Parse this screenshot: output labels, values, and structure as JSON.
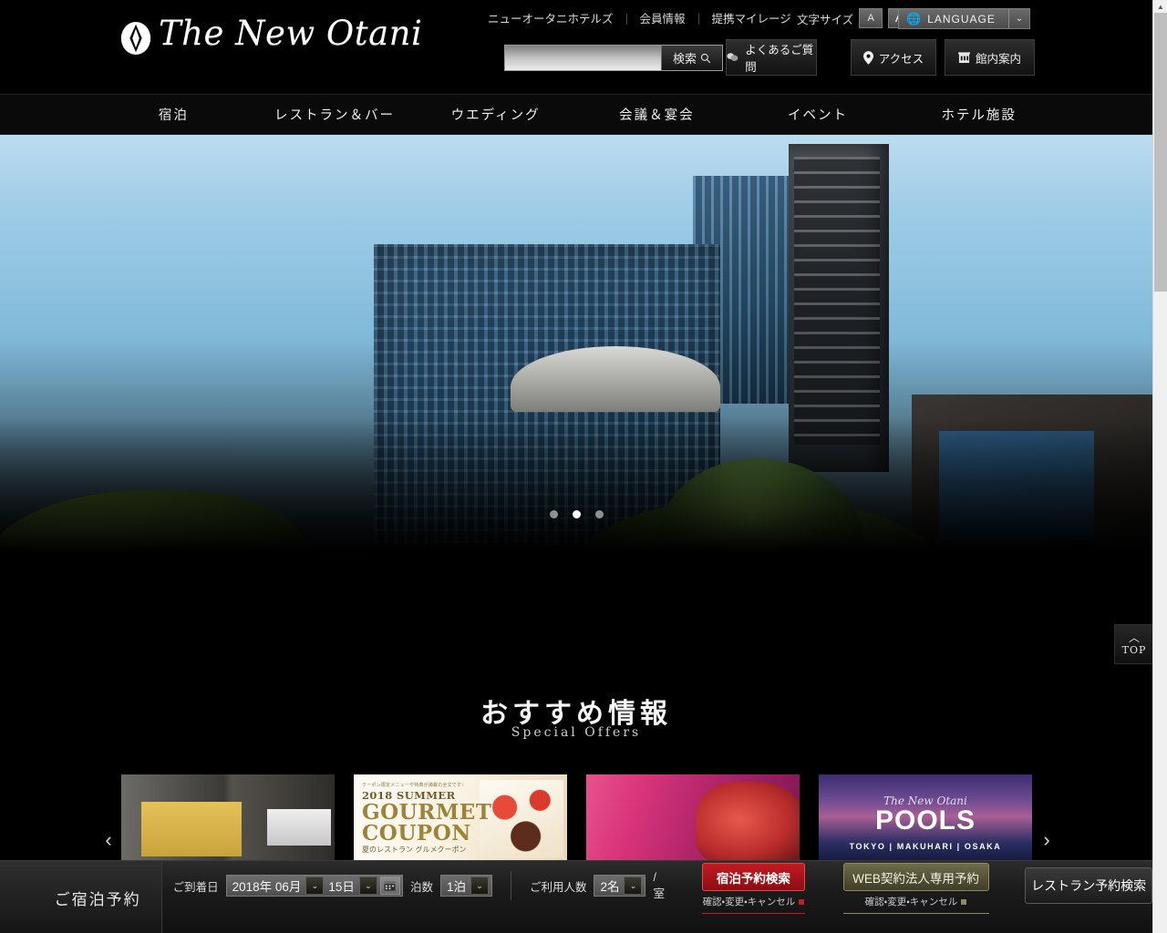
{
  "header": {
    "logo_text": "The New Otani",
    "logo_mark": "diamond-emblem",
    "top_links": [
      {
        "label": "ニューオータニホテルズ"
      },
      {
        "label": "会員情報"
      },
      {
        "label": "提携マイレージ"
      }
    ],
    "fontsize": {
      "label": "文字サイズ",
      "small": "A",
      "large": "A"
    },
    "language": {
      "label": "LANGUAGE",
      "globe_icon": "globe-icon",
      "caret": "⌄"
    },
    "search": {
      "value": "",
      "placeholder": "",
      "button_label": "検索",
      "icon": "search-icon"
    },
    "buttons": [
      {
        "id": "faq",
        "label": "よくあるご質問",
        "icon": "chat-bubbles-icon"
      },
      {
        "id": "access",
        "label": "アクセス",
        "icon": "map-pin-icon"
      },
      {
        "id": "facility",
        "label": "館内案内",
        "icon": "building-icon"
      }
    ]
  },
  "gnav": {
    "items": [
      {
        "label": "宿泊"
      },
      {
        "label": "レストラン＆バー"
      },
      {
        "label": "ウエディング"
      },
      {
        "label": "会議＆宴会"
      },
      {
        "label": "イベント"
      },
      {
        "label": "ホテル施設"
      }
    ]
  },
  "hero": {
    "alt": "ホテルニューオータニ 外観と日本庭園の滝",
    "slide_count": 3,
    "active_slide": 2
  },
  "top_button": {
    "label": "TOP",
    "icon": "chevron-up-icon"
  },
  "offers": {
    "title": "おすすめ情報",
    "subtitle": "Special Offers",
    "prev_arrow": "‹",
    "next_arrow": "›",
    "cards": [
      {
        "id": "guestroom",
        "alt": "客室 バスルームとベッドルーム"
      },
      {
        "id": "gourmet-coupon",
        "kicker": "クーポン限定メニューや特典が満載の全文です!",
        "year": "2018 SUMMER",
        "line1": "GOURMET",
        "line2": "COUPON",
        "jp": "夏のレストラン グルメクーポン"
      },
      {
        "id": "night-event",
        "alt": "ナイトイベント DJ"
      },
      {
        "id": "pools",
        "script": "The New Otani",
        "big": "POOLS",
        "sub": "TOKYO | MAKUHARI | OSAKA"
      }
    ]
  },
  "reservation": {
    "title": "ご宿泊予約",
    "arrival_label": "ご到着日",
    "year_month": "2018年 06月",
    "day": "15日",
    "calendar_icon": "calendar-icon",
    "nights_label": "泊数",
    "nights_value": "1泊",
    "guests_label": "ご利用人数",
    "guests_value": "2名",
    "per_room": "/室",
    "stay_search_label": "宿泊予約検索",
    "stay_sub_label": "確認・変更・キャンセル",
    "stay_sub_color": "#c41a22",
    "corp_label": "WEB契約法人専用予約",
    "corp_sub_label": "確認・変更・キャンセル",
    "corp_sub_color": "#8e8a60",
    "restaurant_label": "レストラン予約検索",
    "caret": "⌄"
  },
  "scrollbar": {
    "up_arrow": "▲",
    "down_arrow": "▼"
  }
}
